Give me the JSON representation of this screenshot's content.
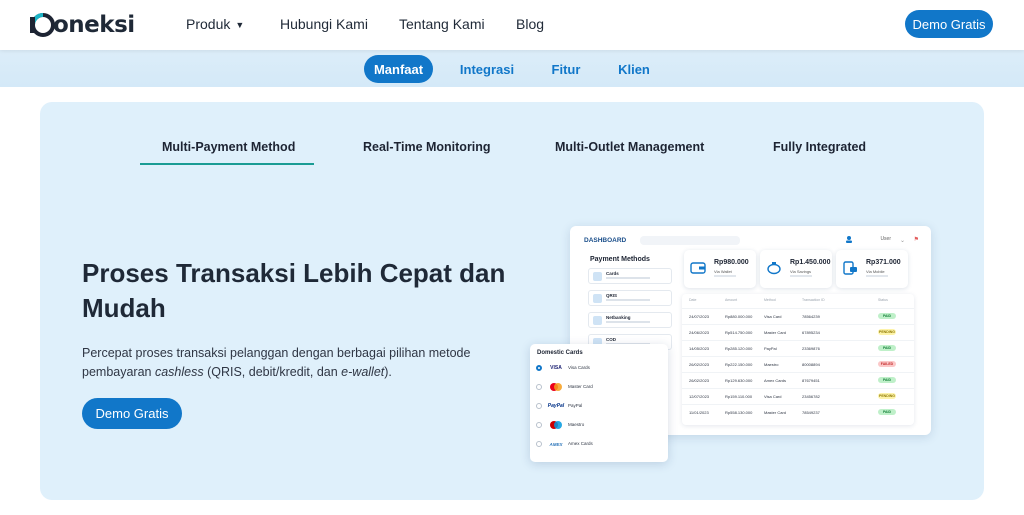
{
  "nav": {
    "logo_text": "oneksi",
    "produk_label": "Produk",
    "hubungi_label": "Hubungi Kami",
    "tentang_label": "Tentang Kami",
    "blog_label": "Blog",
    "demo_label": "Demo Gratis",
    "accent_color": "#1177c9"
  },
  "anchors": [
    {
      "label": "Manfaat",
      "active": true
    },
    {
      "label": "Integrasi",
      "active": false
    },
    {
      "label": "Fitur",
      "active": false
    },
    {
      "label": "Klien",
      "active": false
    }
  ],
  "feature_tabs": [
    {
      "label": "Multi-Payment Method",
      "active": true
    },
    {
      "label": "Real-Time Monitoring",
      "active": false
    },
    {
      "label": "Multi-Outlet Management",
      "active": false
    },
    {
      "label": "Fully Integrated",
      "active": false
    }
  ],
  "content": {
    "heading": "Proses Transaksi Lebih Cepat dan Mudah",
    "desc_part1": "Percepat proses transaksi pelanggan dengan berbagai pilihan metode pembayaran ",
    "desc_cashless": "cashless",
    "desc_part2": " (QRIS, debit/kredit, dan ",
    "desc_ewallet": "e-wallet",
    "desc_part3": ").",
    "cta_label": "Demo Gratis"
  },
  "dashboard": {
    "title": "DASHBOARD",
    "user": "User",
    "payment_methods_title": "Payment Methods",
    "methods": [
      "Cards",
      "QRIS",
      "Netbanking",
      "COD"
    ],
    "stats": [
      {
        "value": "Rp980.000",
        "label": "Via Wallet",
        "icon": "wallet-icon"
      },
      {
        "value": "Rp1.450.000",
        "label": "Via Savings",
        "icon": "piggy-bank-icon"
      },
      {
        "value": "Rp371.000",
        "label": "Via Mobile",
        "icon": "mobile-payment-icon"
      }
    ],
    "table": {
      "headers": [
        "Date",
        "Amount",
        "Method",
        "Transaction ID",
        "Status"
      ],
      "rows": [
        {
          "date": "24/07/2023",
          "amount": "Rp880.000.000",
          "method": "Visa Card",
          "id": "78564239",
          "status": "PAID"
        },
        {
          "date": "24/06/2023",
          "amount": "Rp514.750.000",
          "method": "Master Card",
          "id": "67895234",
          "status": "PENDING"
        },
        {
          "date": "14/05/2023",
          "amount": "Rp285.120.000",
          "method": "PayPal",
          "id": "23369876",
          "status": "PAID"
        },
        {
          "date": "26/02/2023",
          "amount": "Rp222.150.000",
          "method": "Maestro",
          "id": "80008894",
          "status": "FAILED"
        },
        {
          "date": "26/02/2023",
          "amount": "Rp129.630.000",
          "method": "Amex Cards",
          "id": "87679451",
          "status": "PAID"
        },
        {
          "date": "12/07/2023",
          "amount": "Rp159.110.000",
          "method": "Visa Card",
          "id": "23456782",
          "status": "PENDING"
        },
        {
          "date": "11/01/2023",
          "amount": "Rp558.130.000",
          "method": "Master Card",
          "id": "78549237",
          "status": "PAID"
        }
      ]
    }
  },
  "domestic_cards": {
    "title": "Domestic Cards",
    "options": [
      {
        "brand": "VISA",
        "label": "Visa Cards",
        "selected": true,
        "color": "#1a1f71"
      },
      {
        "brand": "MC",
        "label": "Master Card",
        "selected": false,
        "color": "#eb001b"
      },
      {
        "brand": "PayPal",
        "label": "PayPal",
        "selected": false,
        "color": "#003087"
      },
      {
        "brand": "MAE",
        "label": "Maestro",
        "selected": false,
        "color": "#cc0000"
      },
      {
        "brand": "AMEX",
        "label": "Amex Cards",
        "selected": false,
        "color": "#2e77bb"
      }
    ]
  }
}
